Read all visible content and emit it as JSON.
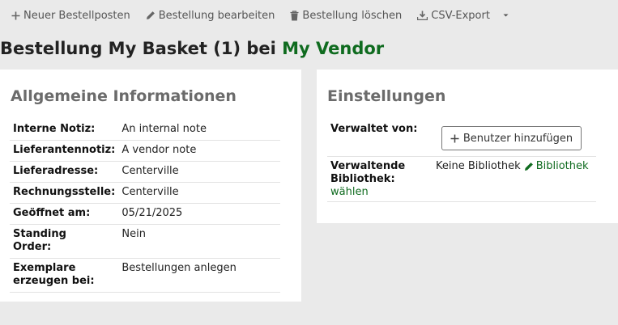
{
  "toolbar": {
    "new_item": "Neuer Bestellposten",
    "edit_order": "Bestellung bearbeiten",
    "delete_order": "Bestellung löschen",
    "csv_export": "CSV-Export"
  },
  "header": {
    "title_prefix": "Bestellung My Basket (1) bei ",
    "vendor": "My Vendor"
  },
  "general_info": {
    "heading": "Allgemeine Informationen",
    "rows": [
      {
        "label": "Interne Notiz:",
        "value": "An internal note"
      },
      {
        "label": "Lieferantennotiz:",
        "value": "A vendor note"
      },
      {
        "label": "Lieferadresse:",
        "value": "Centerville"
      },
      {
        "label": "Rechnungsstelle:",
        "value": "Centerville"
      },
      {
        "label": "Geöffnet am:",
        "value": "05/21/2025"
      },
      {
        "label": "Standing Order:",
        "value": "Nein"
      },
      {
        "label": "Exemplare erzeugen bei:",
        "value": "Bestellungen anlegen"
      }
    ]
  },
  "settings": {
    "heading": "Einstellungen",
    "managed_by_label": "Verwaltet von:",
    "add_user_button": "Benutzer hinzufügen",
    "managing_library_label": "Verwaltende Bibliothek:",
    "choose_link": "wählen",
    "library_value": "Keine Bibliothek",
    "library_edit_link": "Bibliothek"
  },
  "colors": {
    "accent_green": "#0f6b1f",
    "background": "#eaeaea",
    "heading_gray": "#6b6b6b"
  }
}
